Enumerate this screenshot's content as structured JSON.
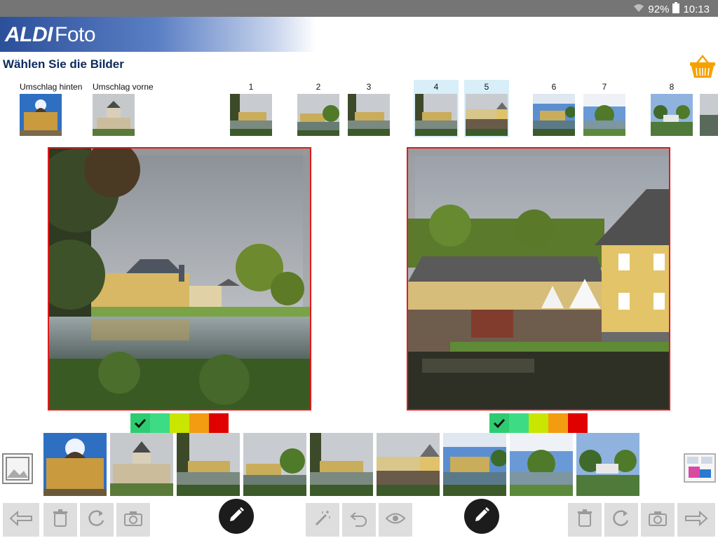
{
  "status": {
    "battery": "92%",
    "time": "10:13"
  },
  "brand": {
    "bold": "ALDI",
    "light": "Foto"
  },
  "page_title": "Wählen Sie die Bilder",
  "covers": [
    {
      "label": "Umschlag hinten"
    },
    {
      "label": "Umschlag vorne"
    }
  ],
  "pages": [
    {
      "label": "1"
    },
    {
      "label": "2"
    },
    {
      "label": "3"
    },
    {
      "label": "4"
    },
    {
      "label": "5"
    },
    {
      "label": "6"
    },
    {
      "label": "7"
    },
    {
      "label": "8"
    }
  ],
  "colors": {
    "accent_blue": "#2c4f9a",
    "selected_border": "#e01b1b",
    "quality": [
      "#2ecc71",
      "#3ddc84",
      "#c8e600",
      "#f39c12",
      "#e00000"
    ]
  }
}
